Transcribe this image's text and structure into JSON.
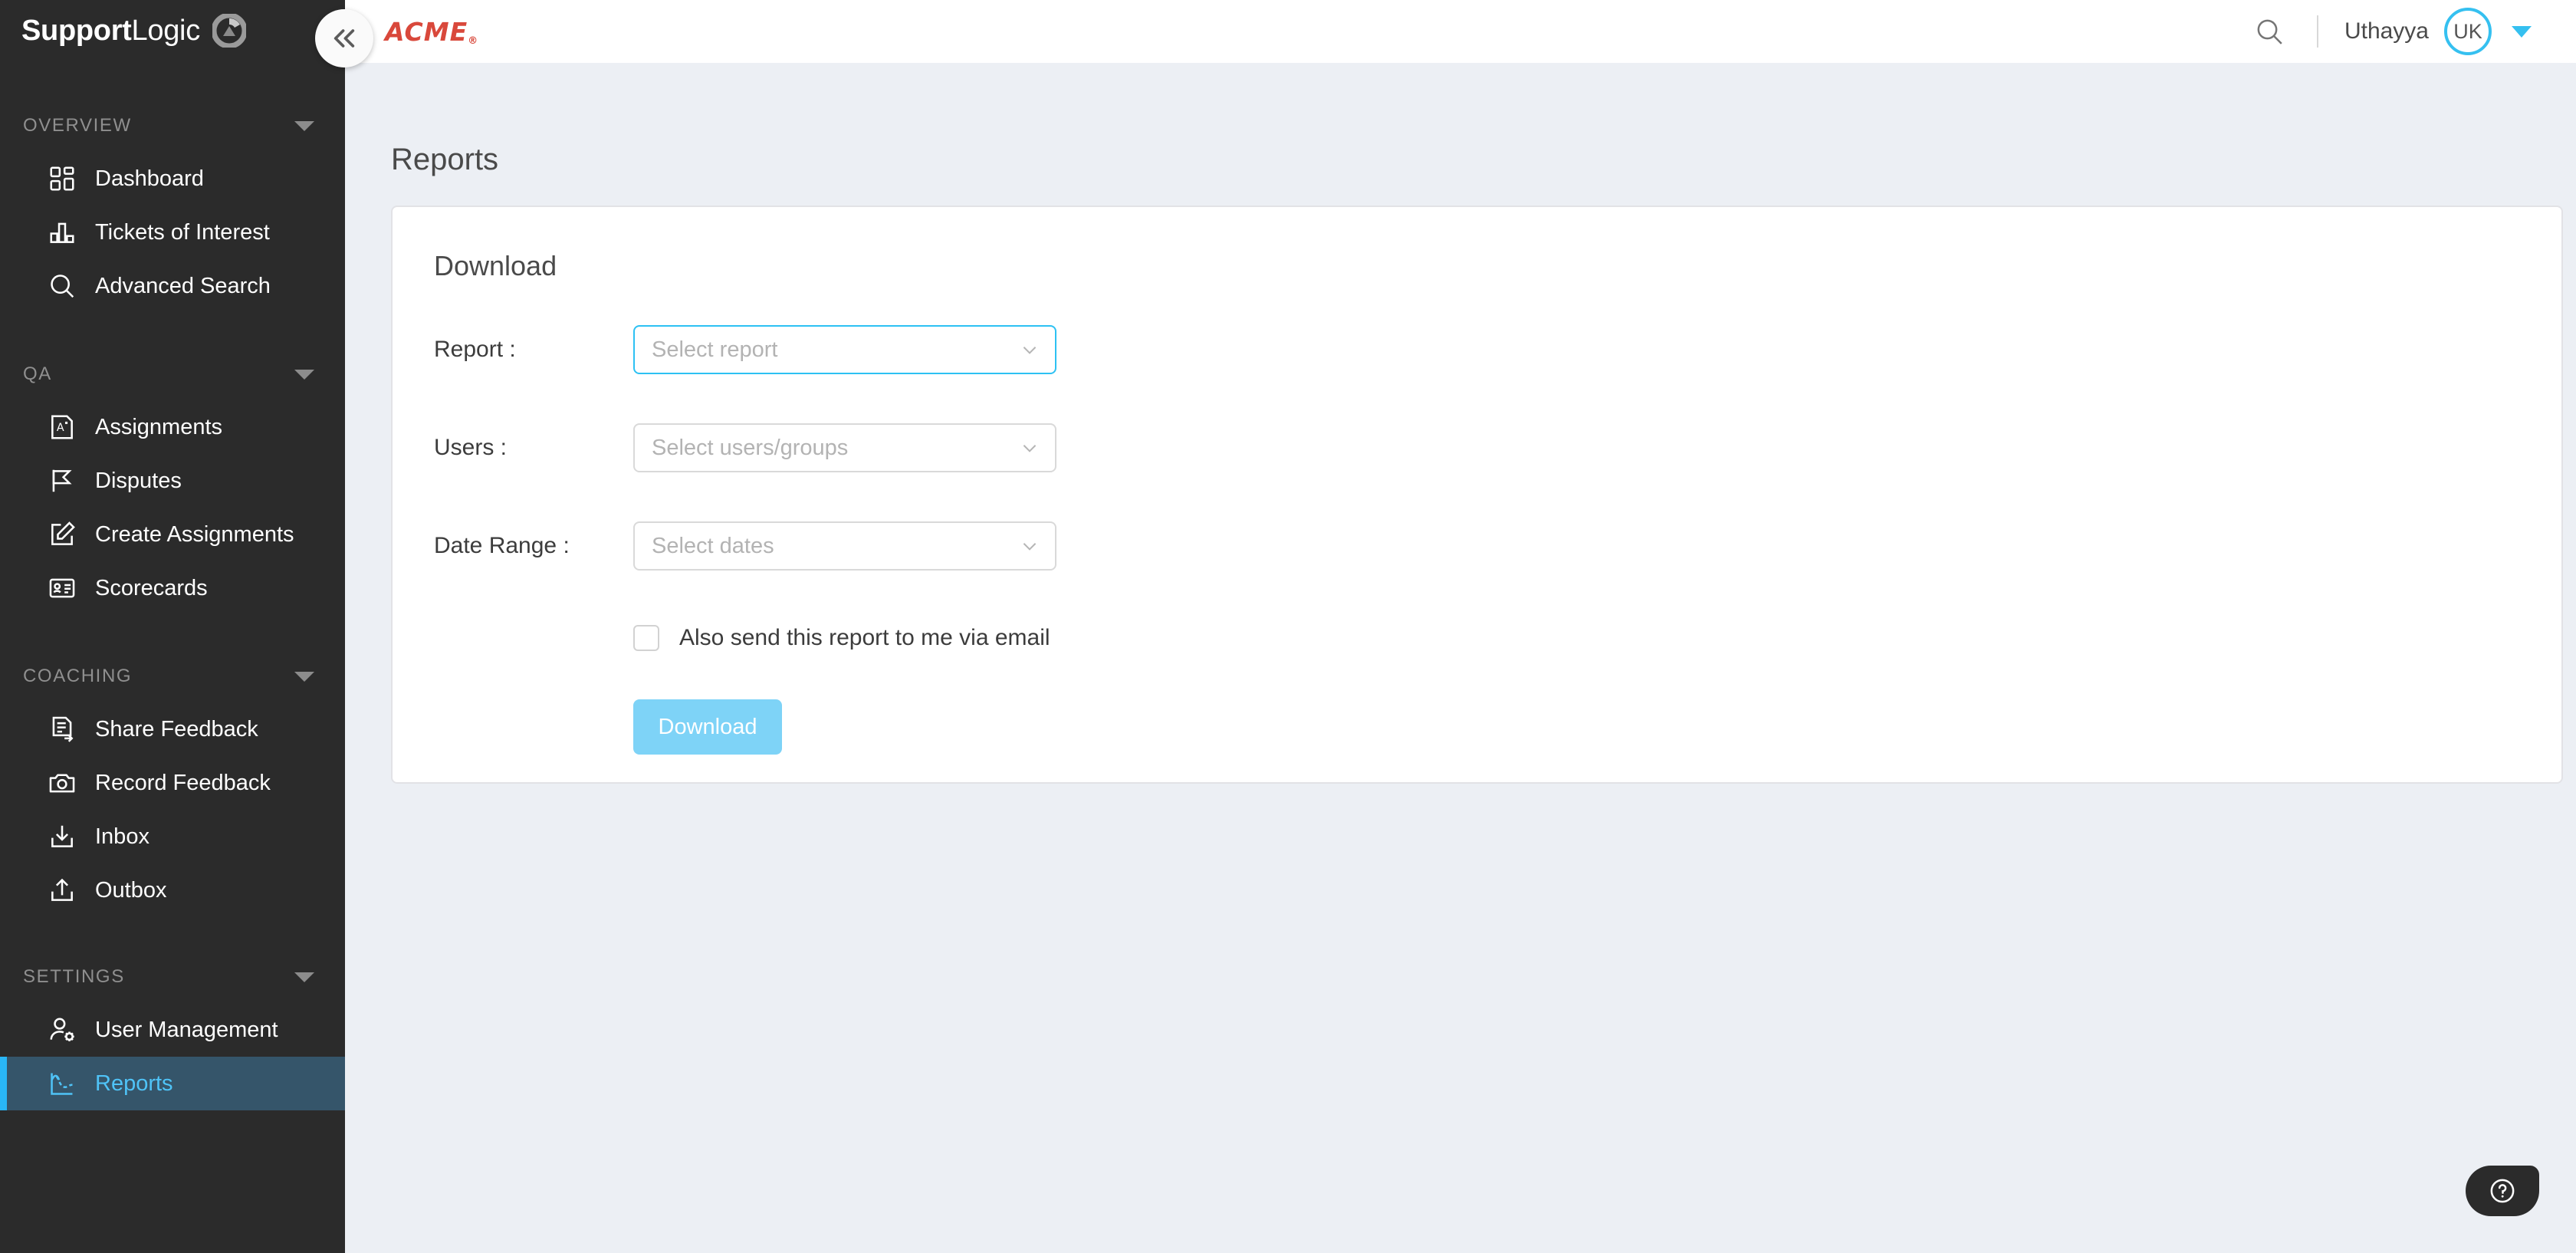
{
  "brand": {
    "name_bold": "Support",
    "name_light": "Logic",
    "logo_icon": "supportlogic-orb-icon"
  },
  "sidebar": {
    "collapse_icon": "double-chevron-left-icon",
    "groups": [
      {
        "title": "OVERVIEW",
        "caret_icon": "caret-down-icon",
        "items": [
          {
            "label": "Dashboard",
            "icon": "dashboard-grid-icon",
            "active": false
          },
          {
            "label": "Tickets of Interest",
            "icon": "bar-chart-icon",
            "active": false
          },
          {
            "label": "Advanced Search",
            "icon": "search-icon",
            "active": false
          }
        ]
      },
      {
        "title": "QA",
        "caret_icon": "caret-down-icon",
        "items": [
          {
            "label": "Assignments",
            "icon": "graded-paper-icon",
            "active": false
          },
          {
            "label": "Disputes",
            "icon": "flag-icon",
            "active": false
          },
          {
            "label": "Create Assignments",
            "icon": "edit-square-icon",
            "active": false
          },
          {
            "label": "Scorecards",
            "icon": "id-card-icon",
            "active": false
          }
        ]
      },
      {
        "title": "COACHING",
        "caret_icon": "caret-down-icon",
        "items": [
          {
            "label": "Share Feedback",
            "icon": "document-arrow-right-icon",
            "active": false
          },
          {
            "label": "Record Feedback",
            "icon": "camera-icon",
            "active": false
          },
          {
            "label": "Inbox",
            "icon": "inbox-download-icon",
            "active": false
          },
          {
            "label": "Outbox",
            "icon": "outbox-upload-icon",
            "active": false
          }
        ]
      },
      {
        "title": "SETTINGS",
        "caret_icon": "caret-down-icon",
        "items": [
          {
            "label": "User Management",
            "icon": "user-gear-icon",
            "active": false
          },
          {
            "label": "Reports",
            "icon": "line-chart-icon",
            "active": true
          }
        ]
      }
    ]
  },
  "topbar": {
    "tenant_logo_text": "ACME",
    "tenant_logo_mark": "®",
    "search_icon": "search-icon",
    "user_name": "Uthayya",
    "user_initials": "UK",
    "user_caret_icon": "caret-down-icon"
  },
  "main": {
    "page_title": "Reports",
    "card": {
      "title": "Download",
      "fields": [
        {
          "label": "Report :",
          "placeholder": "Select report",
          "value": "",
          "focused": true,
          "chevron_icon": "chevron-down-icon"
        },
        {
          "label": "Users :",
          "placeholder": "Select users/groups",
          "value": "",
          "focused": false,
          "chevron_icon": "chevron-down-icon"
        },
        {
          "label": "Date Range :",
          "placeholder": "Select dates",
          "value": "",
          "focused": false,
          "chevron_icon": "chevron-down-icon"
        }
      ],
      "checkbox_label": "Also send this report to me via email",
      "checkbox_checked": false,
      "download_button": "Download"
    }
  },
  "help": {
    "icon": "question-circle-icon"
  },
  "colors": {
    "sidebar_bg": "#2b2b2b",
    "page_bg": "#eceff4",
    "accent_cyan": "#2dc1f3",
    "active_nav_bg": "#35556a",
    "active_nav_text": "#4fc3f7",
    "button_blue": "#7ed3f7",
    "acme_red": "#d9483b"
  }
}
